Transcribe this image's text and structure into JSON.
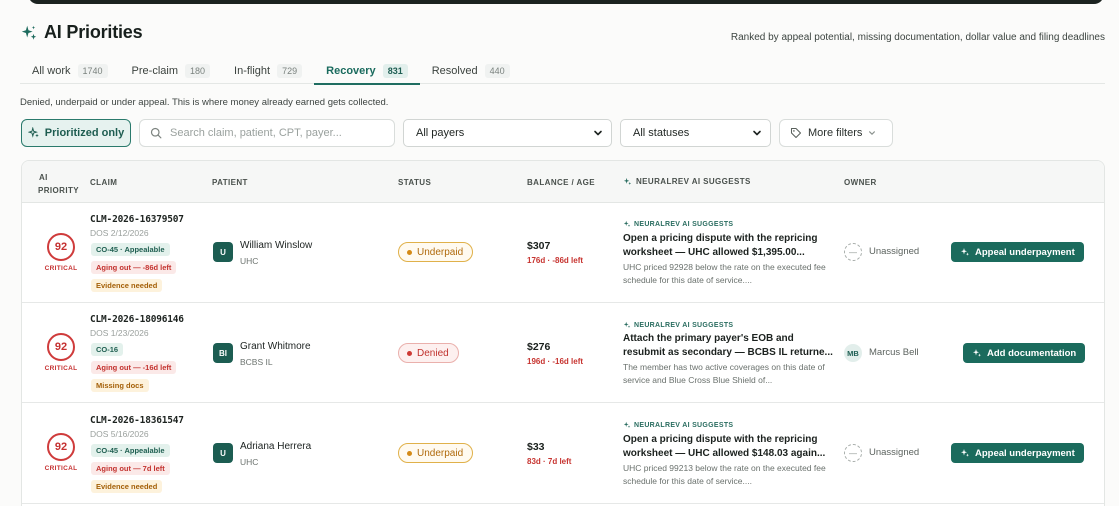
{
  "header": {
    "title": "AI Priorities",
    "subtitle": "Ranked by appeal potential, missing documentation, dollar value and filing deadlines"
  },
  "tabs": [
    {
      "label": "All work",
      "count": "1740"
    },
    {
      "label": "Pre-claim",
      "count": "180"
    },
    {
      "label": "In-flight",
      "count": "729"
    },
    {
      "label": "Recovery",
      "count": "831"
    },
    {
      "label": "Resolved",
      "count": "440"
    }
  ],
  "description": "Denied, underpaid or under appeal. This is where money already earned gets collected.",
  "filters": {
    "prioritized_label": "Prioritized only",
    "search_placeholder": "Search claim, patient, CPT, payer...",
    "payers_value": "All payers",
    "payers_options": [
      "All payers"
    ],
    "status_value": "All statuses",
    "status_options": [
      "All statuses"
    ],
    "more_label": "More filters"
  },
  "table": {
    "headers": {
      "ai_priority_1": "AI",
      "ai_priority_2": "PRIORITY",
      "claim": "CLAIM",
      "patient": "PATIENT",
      "status": "STATUS",
      "balance": "BALANCE / AGE",
      "suggests": "NEURALREV AI SUGGESTS",
      "owner": "OWNER"
    },
    "rows": [
      {
        "score": "92",
        "level": "CRITICAL",
        "claim_id": "CLM-2026-16379507",
        "dos": "DOS 2/12/2026",
        "tags": [
          {
            "text": "CO-45 · Appealable",
            "tone": "green"
          },
          {
            "text": "Aging out — -86d left",
            "tone": "red"
          },
          {
            "text": "Evidence needed",
            "tone": "amber"
          }
        ],
        "avatar": "U",
        "patient": "William Winslow",
        "payer": "UHC",
        "status": "Underpaid",
        "balance": "$307",
        "age": "176d · -86d left",
        "suggest_label": "NEURALREV AI SUGGESTS",
        "suggest_title": "Open a pricing dispute with the repricing worksheet — UHC allowed $1,395.00...",
        "suggest_text": "UHC priced 92928 below the rate on the executed fee schedule for this date of service....",
        "owner_initials": "—",
        "owner": "Unassigned",
        "action": "Appeal underpayment"
      },
      {
        "score": "92",
        "level": "CRITICAL",
        "claim_id": "CLM-2026-18096146",
        "dos": "DOS 1/23/2026",
        "tags": [
          {
            "text": "CO-16",
            "tone": "green"
          },
          {
            "text": "Aging out — -16d left",
            "tone": "red"
          },
          {
            "text": "Missing docs",
            "tone": "amber"
          }
        ],
        "avatar": "BI",
        "patient": "Grant Whitmore",
        "payer": "BCBS IL",
        "status": "Denied",
        "balance": "$276",
        "age": "196d · -16d left",
        "suggest_label": "NEURALREV AI SUGGESTS",
        "suggest_title": "Attach the primary payer's EOB and resubmit as secondary — BCBS IL returne...",
        "suggest_text": "The member has two active coverages on this date of service and Blue Cross Blue Shield of...",
        "owner_initials": "MB",
        "owner": "Marcus Bell",
        "action": "Add documentation"
      },
      {
        "score": "92",
        "level": "CRITICAL",
        "claim_id": "CLM-2026-18361547",
        "dos": "DOS 5/16/2026",
        "tags": [
          {
            "text": "CO-45 · Appealable",
            "tone": "green"
          },
          {
            "text": "Aging out — 7d left",
            "tone": "red"
          },
          {
            "text": "Evidence needed",
            "tone": "amber"
          }
        ],
        "avatar": "U",
        "patient": "Adriana Herrera",
        "payer": "UHC",
        "status": "Underpaid",
        "balance": "$33",
        "age": "83d · 7d left",
        "suggest_label": "NEURALREV AI SUGGESTS",
        "suggest_title": "Open a pricing dispute with the repricing worksheet — UHC allowed $148.03 again...",
        "suggest_text": "UHC priced 99213 below the rate on the executed fee schedule for this date of service....",
        "owner_initials": "—",
        "owner": "Unassigned",
        "action": "Appeal underpayment"
      }
    ]
  },
  "icons": {
    "title": "sparkle-icon",
    "search": "search-icon",
    "more": "tag-icon",
    "dropdown": "chevron-down-icon"
  },
  "colors": {
    "brand": "#1b6b5d",
    "critical": "#cf3b3b",
    "underpaid": "#d48a17",
    "denied": "#cd3a34"
  }
}
